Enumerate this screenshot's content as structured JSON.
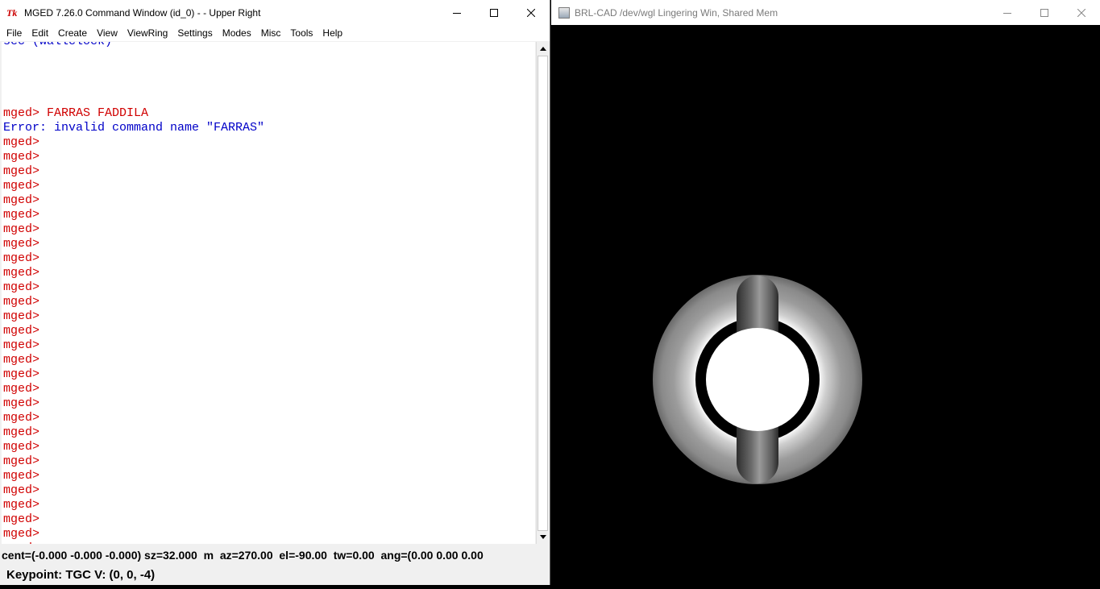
{
  "left_window": {
    "title": "MGED 7.26.0 Command Window (id_0) -  - Upper Right",
    "logo_text": "Tk",
    "menu": [
      "File",
      "Edit",
      "Create",
      "View",
      "ViewRing",
      "Settings",
      "Modes",
      "Misc",
      "Tools",
      "Help"
    ],
    "console": {
      "partial_top_line": "sec (wallclock)",
      "command_prompt": "mged> ",
      "command_text": "FARRAS FADDILA",
      "error_line": "Error: invalid command name \"FARRAS\"",
      "prompt": "mged>",
      "empty_prompt_count": 30
    },
    "status_line": "cent=(-0.000 -0.000 -0.000) sz=32.000  m  az=270.00  el=-90.00  tw=0.00  ang=(0.00 0.00 0.00",
    "keypoint_line": "Keypoint: TGC V: (0, 0, -4)"
  },
  "right_window": {
    "title": "BRL-CAD /dev/wgl Lingering Win, Shared Mem",
    "icon": "brlcad-window-icon"
  },
  "colors": {
    "prompt": "#d00000",
    "output_blue": "#0000c8",
    "cursor": "#ffff00",
    "viewport_bg": "#000000"
  }
}
